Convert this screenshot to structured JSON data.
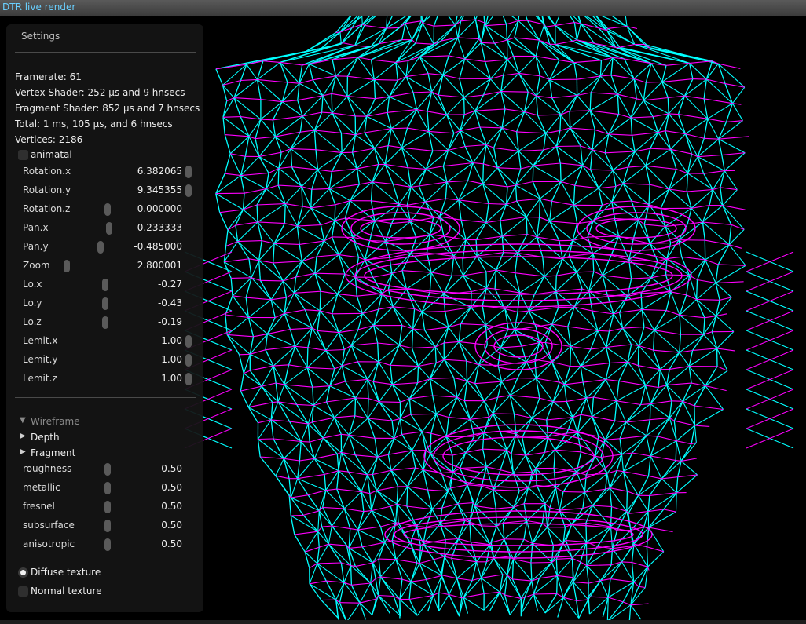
{
  "window": {
    "title": "DTR live render"
  },
  "panel": {
    "title": "Settings",
    "stats": [
      "Framerate: 61",
      "Vertex Shader: 252 μs and 9 hnsecs",
      "Fragment Shader: 852 μs and 7 hnsecs",
      "Total: 1 ms, 105 μs, and 6 hnsecs",
      "Vertices: 2186"
    ],
    "animate": {
      "label": "animatal",
      "checked": false
    },
    "sliders": [
      {
        "label": "Rotation.x",
        "value": "6.382065",
        "fraction": 1.0
      },
      {
        "label": "Rotation.y",
        "value": "9.345355",
        "fraction": 1.0
      },
      {
        "label": "Rotation.z",
        "value": "0.000000",
        "fraction": 0.5
      },
      {
        "label": "Pan.x",
        "value": "0.233333",
        "fraction": 0.51
      },
      {
        "label": "Pan.y",
        "value": "-0.485000",
        "fraction": 0.46
      },
      {
        "label": "Zoom",
        "value": "2.800001",
        "fraction": 0.25
      },
      {
        "label": "Lo.x",
        "value": "-0.27",
        "fraction": 0.49
      },
      {
        "label": "Lo.y",
        "value": "-0.43",
        "fraction": 0.49
      },
      {
        "label": "Lo.z",
        "value": "-0.19",
        "fraction": 0.49
      },
      {
        "label": "Lemit.x",
        "value": "1.00",
        "fraction": 1.0
      },
      {
        "label": "Lemit.y",
        "value": "1.00",
        "fraction": 1.0
      },
      {
        "label": "Lemit.z",
        "value": "1.00",
        "fraction": 1.0
      }
    ],
    "tree": [
      {
        "label": "Wireframe",
        "expanded": true
      },
      {
        "label": "Depth",
        "expanded": false
      },
      {
        "label": "Fragment",
        "expanded": false
      }
    ],
    "material_sliders": [
      {
        "label": "roughness",
        "value": "0.50",
        "fraction": 0.5
      },
      {
        "label": "metallic",
        "value": "0.50",
        "fraction": 0.5
      },
      {
        "label": "fresnel",
        "value": "0.50",
        "fraction": 0.5
      },
      {
        "label": "subsurface",
        "value": "0.50",
        "fraction": 0.5
      },
      {
        "label": "anisotropic",
        "value": "0.50",
        "fraction": 0.5
      }
    ],
    "textures": [
      {
        "label": "Diffuse texture",
        "checked": true
      },
      {
        "label": "Normal  texture",
        "checked": false
      }
    ]
  },
  "colors": {
    "wire_cyan": "#00ffff",
    "wire_magenta": "#ff00ff",
    "background": "#000000"
  }
}
